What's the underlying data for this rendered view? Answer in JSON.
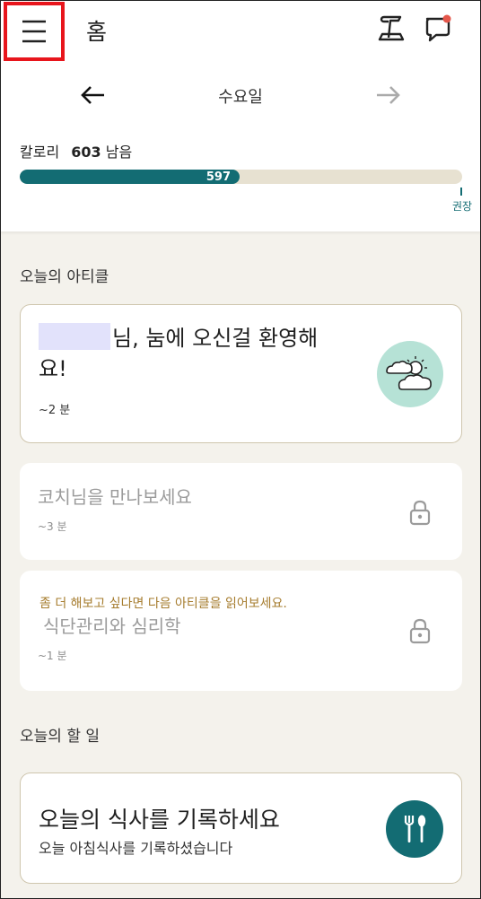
{
  "header": {
    "title": "홈",
    "menu_icon": "hamburger-menu-icon",
    "log_icon": "food-log-icon",
    "messages_icon": "chat-bubble-icon",
    "notification_color": "#e4574b"
  },
  "day_nav": {
    "label": "수요일"
  },
  "calories": {
    "label": "칼로리",
    "remaining_value": "603",
    "remaining_suffix": "남음",
    "consumed": "597",
    "progress_fraction": 0.497,
    "recommended_label": "권장",
    "bar_color": "#136c73",
    "track_color": "#e7e1d1"
  },
  "articles": {
    "section_title": "오늘의 아티클",
    "featured": {
      "title_rest": "님, 눔에 오신걸 환영해요!",
      "duration": "~2 분",
      "icon": "weather-cloud-sun-icon"
    },
    "locked": [
      {
        "title": "코치님을 만나보세요",
        "duration": "~3 분",
        "icon": "lock-icon"
      },
      {
        "hint": "좀 더 해보고 싶다면 다음 아티클을 읽어보세요.",
        "title": "식단관리와 심리학",
        "duration": "~1 분",
        "icon": "lock-icon"
      }
    ]
  },
  "todo": {
    "section_title": "오늘의 할 일",
    "card": {
      "title": "오늘의 식사를 기록하세요",
      "subtitle": "오늘 아침식사를 기록하셨습니다",
      "icon": "fork-spoon-icon"
    }
  },
  "colors": {
    "accent": "#136c73",
    "background": "#f4f2ec",
    "hint_gold": "#a67c2e",
    "highlight_border": "#e8151c"
  }
}
